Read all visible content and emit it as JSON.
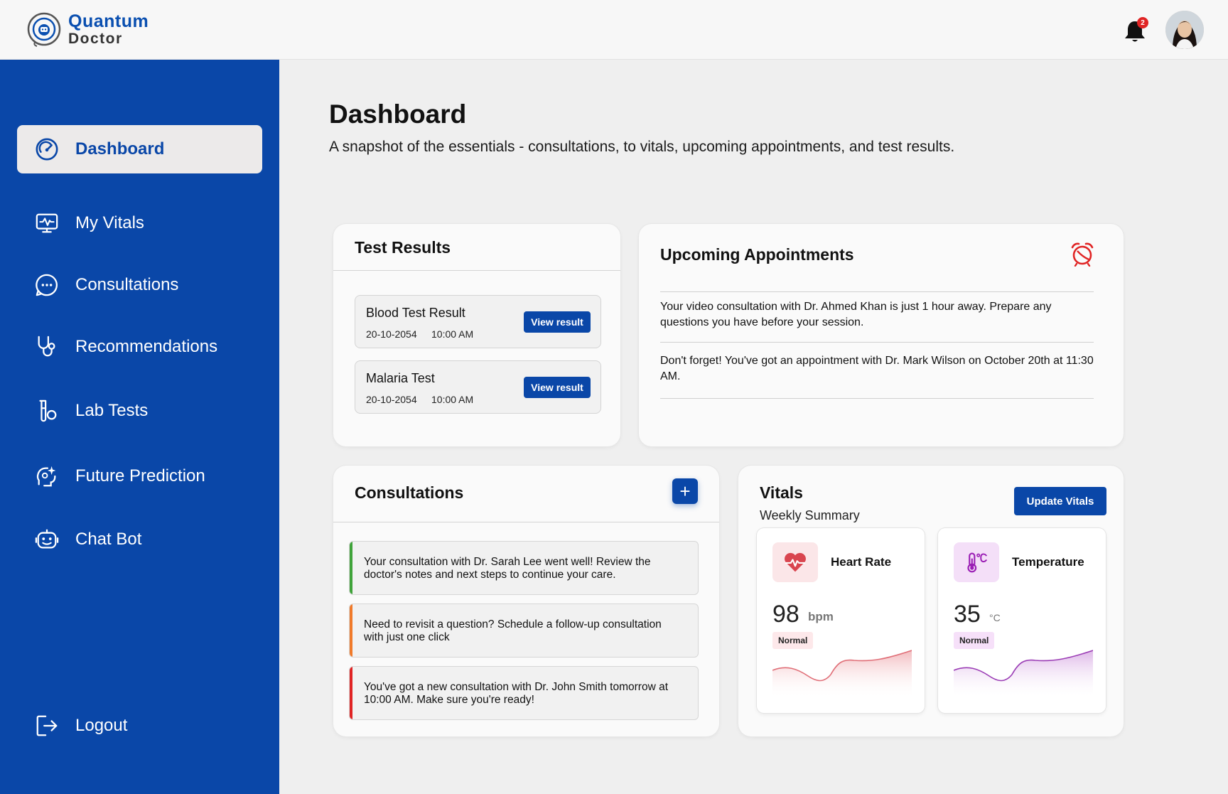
{
  "header": {
    "logo_line1": "Quantum",
    "logo_line2": "Doctor",
    "notification_count": "2"
  },
  "sidebar": {
    "items": [
      {
        "label": "Dashboard",
        "icon": "dashboard-gauge-icon",
        "active": true
      },
      {
        "label": "My Vitals",
        "icon": "monitor-pulse-icon"
      },
      {
        "label": "Consultations",
        "icon": "chat-bubble-icon"
      },
      {
        "label": "Recommendations",
        "icon": "stethoscope-icon"
      },
      {
        "label": "Lab Tests",
        "icon": "flask-icon"
      },
      {
        "label": "Future Prediction",
        "icon": "brain-sparkle-icon"
      },
      {
        "label": "Chat Bot",
        "icon": "robot-icon"
      }
    ],
    "logout": "Logout"
  },
  "page": {
    "title": "Dashboard",
    "subtitle": "A snapshot of the essentials - consultations, to vitals, upcoming appointments, and test results."
  },
  "test_results": {
    "title": "Test Results",
    "items": [
      {
        "name": "Blood Test Result",
        "date": "20-10-2054",
        "time": "10:00 AM",
        "button": "View result"
      },
      {
        "name": "Malaria Test",
        "date": "20-10-2054",
        "time": "10:00 AM",
        "button": "View result"
      }
    ]
  },
  "appointments": {
    "title": "Upcoming Appointments",
    "items": [
      "Your video consultation with Dr. Ahmed Khan is just 1 hour away. Prepare any questions you have before your session.",
      "Don't forget! You've got an appointment with Dr. Mark Wilson on October 20th at 11:30 AM."
    ]
  },
  "consultations": {
    "title": "Consultations",
    "add_label": "+",
    "items": [
      {
        "text": "Your consultation with Dr. Sarah Lee went well! Review the doctor's notes and next steps to continue your care.",
        "color": "#3fa33a"
      },
      {
        "text": "Need to revisit a question? Schedule a follow-up consultation with just one click",
        "color": "#f07a2a"
      },
      {
        "text": "You've got a new consultation with Dr. John Smith tomorrow at 10:00 AM. Make sure you're ready!",
        "color": "#e02424"
      }
    ]
  },
  "vitals": {
    "title": "Vitals",
    "subtitle": "Weekly Summary",
    "update_button": "Update Vitals",
    "cards": [
      {
        "label": "Heart Rate",
        "value": "98",
        "unit": "bpm",
        "status": "Normal",
        "icon": "heart-pulse-icon",
        "accent": "#d9454f"
      },
      {
        "label": "Temperature",
        "value": "35",
        "unit": "°C",
        "status": "Normal",
        "icon": "thermometer-icon",
        "accent": "#9b1fb5"
      }
    ]
  },
  "colors": {
    "brand_blue": "#0a47a8",
    "background": "#efefef"
  }
}
